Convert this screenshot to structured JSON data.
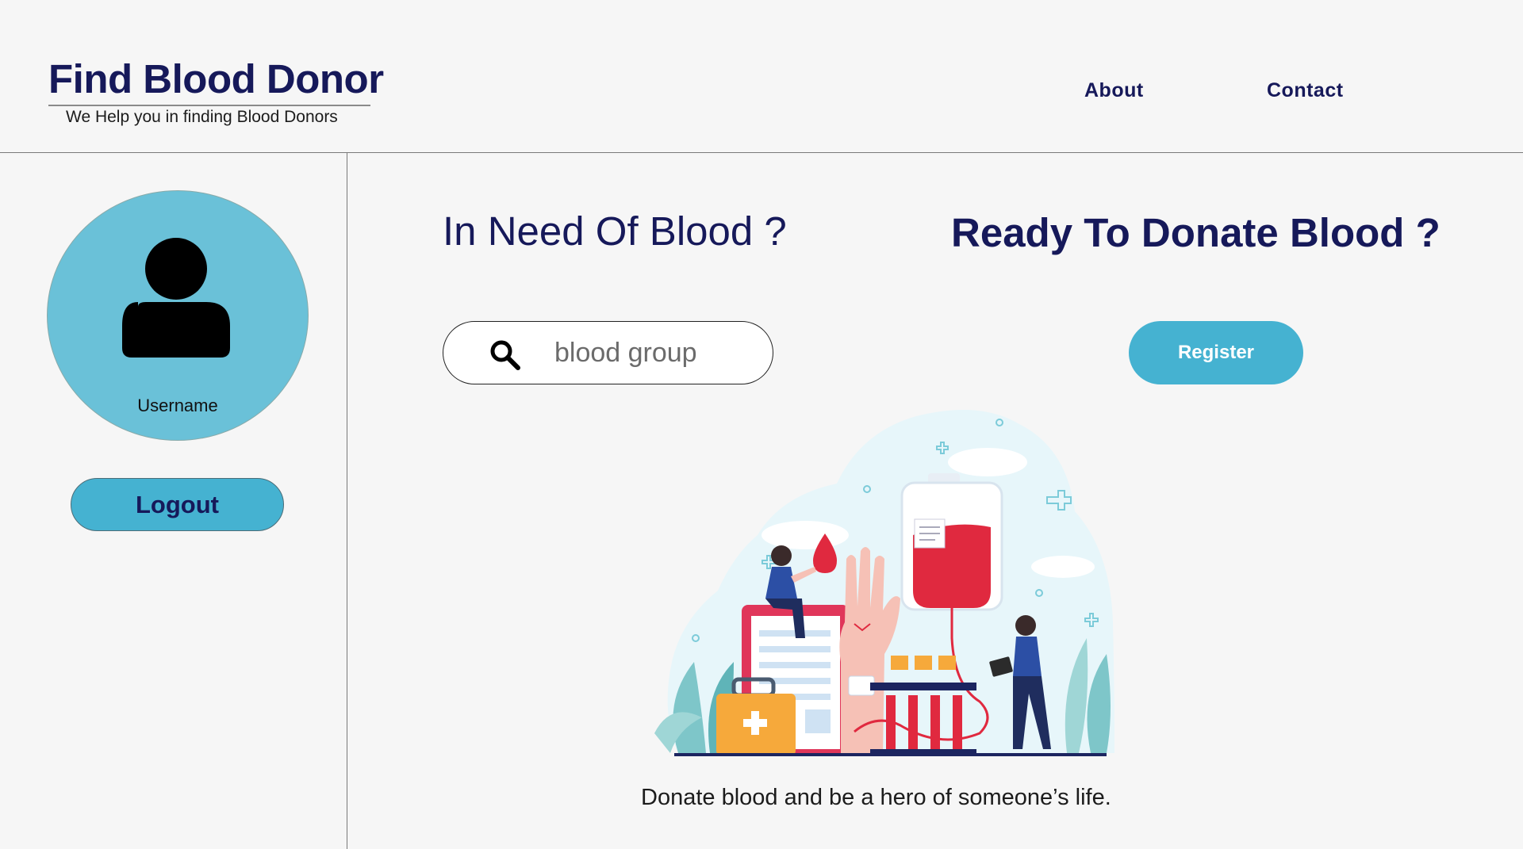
{
  "header": {
    "brand_title": "Find Blood Donor",
    "brand_tagline": "We Help you in finding Blood Donors",
    "nav": {
      "about": "About",
      "contact": "Contact"
    }
  },
  "sidebar": {
    "username": "Username",
    "logout_label": "Logout",
    "avatar_icon": "user-silhouette-icon"
  },
  "main": {
    "need_heading": "In Need Of Blood ?",
    "donate_heading": "Ready To Donate Blood ?",
    "search": {
      "placeholder": "blood group",
      "icon": "search-icon"
    },
    "register_label": "Register",
    "tagline": "Donate blood and be a hero of someone’s life."
  },
  "colors": {
    "brand_navy": "#16195a",
    "accent_blue": "#45b2d1",
    "avatar_bg": "#6ac1d8",
    "page_bg": "#f6f6f6",
    "blood_red": "#e0293f"
  }
}
